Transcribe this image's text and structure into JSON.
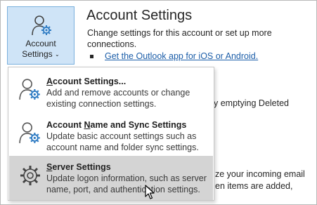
{
  "account_button": {
    "line1": "Account",
    "line2": "Settings",
    "icon": "user-gear-icon"
  },
  "info": {
    "title": "Account Settings",
    "description": "Change settings for this account or set up more connections.",
    "link": "Get the Outlook app for iOS or Android.",
    "partial_1": "y emptying Deleted",
    "partial_2": "ze your incoming email",
    "partial_3": "en items are added,"
  },
  "menu": {
    "items": [
      {
        "title_pre": "",
        "title_underline": "A",
        "title_post": "ccount Settings...",
        "description": "Add and remove accounts or change existing connection settings.",
        "icon": "user-gear-icon"
      },
      {
        "title_pre": "Account ",
        "title_underline": "N",
        "title_post": "ame and Sync Settings",
        "description": "Update basic account settings such as account name and folder sync settings.",
        "icon": "user-gear-icon"
      },
      {
        "title_pre": "",
        "title_underline": "S",
        "title_post": "erver Settings",
        "description": "Update logon information, such as server name, port, and authentication settings.",
        "icon": "gear-icon"
      }
    ]
  },
  "colors": {
    "button_bg": "#cfe4f7",
    "button_border": "#7ab0dd",
    "link": "#1b5da8",
    "highlight": "#d4d4d4",
    "icon_accent": "#2b79c2"
  }
}
